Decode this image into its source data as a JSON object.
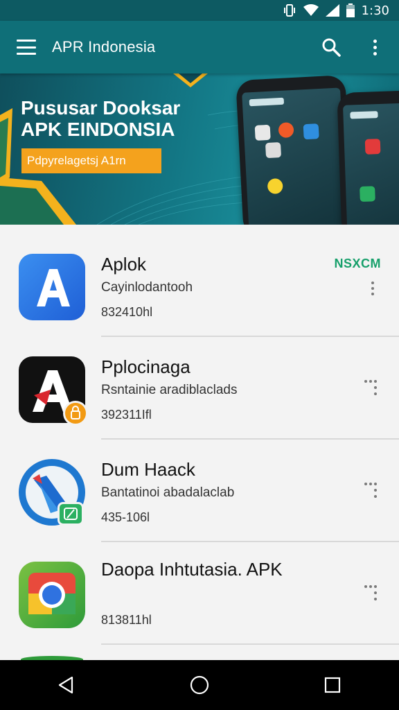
{
  "status_bar": {
    "time": "1:30",
    "icons": [
      "vibrate-icon",
      "wifi-icon",
      "signal-icon",
      "battery-icon"
    ]
  },
  "app_bar": {
    "title": "APR Indonesia",
    "icons": [
      "menu-icon",
      "search-icon",
      "more-vert-icon"
    ]
  },
  "banner": {
    "title_line1": "Pususar Dooksar",
    "title_line2": "APK EINDONSIA",
    "tagline": "Pdpyrelagetsj A1rn"
  },
  "apps": [
    {
      "name": "Aplok",
      "description": "Cayinlodantooh",
      "meta": "832410hl",
      "badge": "NSXCM",
      "icon": "app-a-blue-icon"
    },
    {
      "name": "Pplocinaga",
      "description": "Rsntainie aradiblaclads",
      "meta": "392311Ifl",
      "icon": "app-a-black-icon"
    },
    {
      "name": "Dum Haack",
      "description": "Bantatinoi abadalaclab",
      "meta": "435-106l",
      "icon": "app-pen-blue-icon"
    },
    {
      "name": "Daopa Inhtutasia. APK",
      "description": "",
      "meta": "813811hl",
      "icon": "chrome-like-icon"
    }
  ],
  "colors": {
    "app_bar": "#0f6f78",
    "status_bar": "#0d5a62",
    "accent": "#f4a21d",
    "badge": "#17a06b"
  },
  "nav_bar": {
    "icons": [
      "back-icon",
      "home-icon",
      "recents-icon"
    ]
  }
}
